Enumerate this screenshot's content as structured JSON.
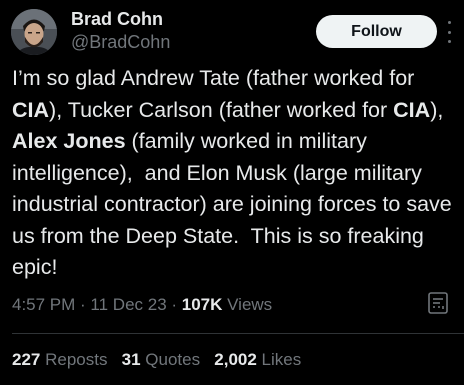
{
  "author": {
    "display_name": "Brad Cohn",
    "handle": "@BradCohn",
    "avatar": "profile-photo"
  },
  "follow_button": {
    "label": "Follow"
  },
  "more_menu": {
    "icon": "more-vertical-icon"
  },
  "tweet": {
    "segments": [
      {
        "text": "I’m so glad Andrew Tate (father worked for ",
        "bold": false
      },
      {
        "text": "CIA",
        "bold": true
      },
      {
        "text": "), Tucker Carlson (father worked for ",
        "bold": false
      },
      {
        "text": "CIA",
        "bold": true
      },
      {
        "text": "), ",
        "bold": false
      },
      {
        "text": "Alex Jones",
        "bold": true
      },
      {
        "text": " (family worked in military intelligence),  and Elon Musk (large military industrial contractor) are joining forces to save us from the Deep State.  This is so freaking epic!",
        "bold": false
      }
    ]
  },
  "meta": {
    "time": "4:57 PM",
    "separator": " · ",
    "date": "11 Dec 23",
    "separator2": " · ",
    "views_count": "107K",
    "views_label": " Views"
  },
  "analytics": {
    "icon": "analytics-icon"
  },
  "stats": {
    "reposts": {
      "count": "227",
      "label": " Reposts"
    },
    "quotes": {
      "count": "31",
      "label": " Quotes"
    },
    "likes": {
      "count": "2,002",
      "label": " Likes"
    }
  },
  "colors": {
    "background": "#000000",
    "primary_text": "#e7e9ea",
    "secondary_text": "#71767b",
    "follow_bg": "#eff3f4",
    "divider": "#2f3336"
  }
}
